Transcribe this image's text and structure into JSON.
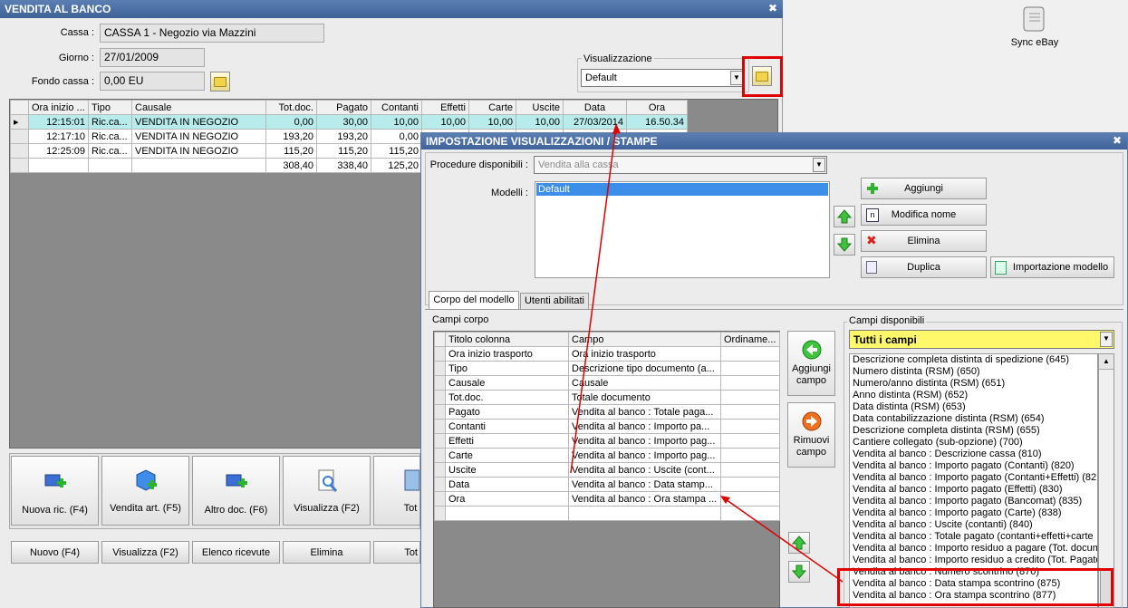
{
  "main_window": {
    "title": "VENDITA AL BANCO",
    "cassa_label": "Cassa :",
    "cassa_value": "CASSA 1 - Negozio via Mazzini",
    "giorno_label": "Giorno :",
    "giorno_value": "27/01/2009",
    "fondo_label": "Fondo cassa :",
    "fondo_value": "0,00 EU",
    "visualizzazione_label": "Visualizzazione",
    "visualizzazione_value": "Default",
    "table": {
      "headers": [
        "Ora inizio ...",
        "Tipo",
        "Causale",
        "Tot.doc.",
        "Pagato",
        "Contanti",
        "Effetti",
        "Carte",
        "Uscite",
        "Data",
        "Ora"
      ],
      "rows": [
        [
          "12:15:01",
          "Ric.ca...",
          "VENDITA IN NEGOZIO",
          "0,00",
          "30,00",
          "10,00",
          "10,00",
          "10,00",
          "10,00",
          "27/03/2014",
          "16.50.34"
        ],
        [
          "12:17:10",
          "Ric.ca...",
          "VENDITA IN NEGOZIO",
          "193,20",
          "193,20",
          "0,00",
          "",
          "",
          "",
          "",
          ""
        ],
        [
          "12:25:09",
          "Ric.ca...",
          "VENDITA IN NEGOZIO",
          "115,20",
          "115,20",
          "115,20",
          "",
          "",
          "",
          "",
          ""
        ],
        [
          "",
          "",
          "",
          "308,40",
          "338,40",
          "125,20",
          "",
          "",
          "",
          "",
          ""
        ]
      ]
    },
    "big_buttons": [
      "Nuova ric. (F4)",
      "Vendita art. (F5)",
      "Altro doc. (F6)",
      "Visualizza (F2)",
      "Tot"
    ],
    "bottom_buttons": [
      "Nuovo (F4)",
      "Visualizza (F2)",
      "Elenco ricevute",
      "Elimina",
      "Tot"
    ]
  },
  "desktop": {
    "sync_label": "Sync eBay"
  },
  "dialog": {
    "title": "IMPOSTAZIONE VISUALIZZAZIONI / STAMPE",
    "procedure_label": "Procedure disponibili :",
    "procedure_value": "Vendita alla cassa",
    "modelli_label": "Modelli :",
    "modelli_items": [
      "Default"
    ],
    "buttons": {
      "aggiungi": "Aggiungi",
      "modifica": "Modifica nome",
      "elimina": "Elimina",
      "duplica": "Duplica",
      "importazione": "Importazione modello"
    },
    "tabs": [
      "Corpo del modello",
      "Utenti abilitati"
    ],
    "campi_corpo_label": "Campi corpo",
    "campi_table": {
      "headers": [
        "Titolo colonna",
        "Campo",
        "Ordiname..."
      ],
      "rows": [
        [
          "Ora inizio trasporto",
          "Ora inizio trasporto",
          ""
        ],
        [
          "Tipo",
          "Descrizione tipo documento (a...",
          ""
        ],
        [
          "Causale",
          "Causale",
          ""
        ],
        [
          "Tot.doc.",
          "Totale documento",
          ""
        ],
        [
          "Pagato",
          "Vendita al banco : Totale paga...",
          ""
        ],
        [
          "Contanti",
          "Vendita al banco : Importo pa...",
          ""
        ],
        [
          "Effetti",
          "Vendita al banco : Importo pag...",
          ""
        ],
        [
          "Carte",
          "Vendita al banco : Importo pag...",
          ""
        ],
        [
          "Uscite",
          "Vendita al banco : Uscite (cont...",
          ""
        ],
        [
          "Data",
          "Vendita al banco : Data stamp...",
          ""
        ],
        [
          "Ora",
          "Vendita al banco : Ora stampa ...",
          ""
        ],
        [
          "",
          "",
          ""
        ]
      ]
    },
    "aggiungi_campo": "Aggiungi campo",
    "rimuovi_campo": "Rimuovi campo",
    "campi_disponibili_label": "Campi disponibili",
    "campi_filter": "Tutti i campi",
    "campi_list": [
      "Descrizione completa distinta di spedizione (645)",
      "Numero distinta (RSM) (650)",
      "Numero/anno distinta (RSM) (651)",
      "Anno distinta (RSM) (652)",
      "Data distinta (RSM) (653)",
      "Data contabilizzazione distinta (RSM) (654)",
      "Descrizione completa distinta (RSM) (655)",
      "Cantiere collegato (sub-opzione) (700)",
      "Vendita al banco : Descrizione cassa (810)",
      "Vendita al banco  : Importo pagato (Contanti) (820)",
      "Vendita al banco  : Importo pagato (Contanti+Effetti) (82",
      "Vendita al banco  : Importo pagato (Effetti) (830)",
      "Vendita al banco  : Importo pagato (Bancomat) (835)",
      "Vendita al banco  : Importo pagato (Carte) (838)",
      "Vendita al banco  : Uscite (contanti) (840)",
      "Vendita al banco  : Totale pagato (contanti+effetti+carte",
      "Vendita al banco : Importo residuo a pagare (Tot. docum",
      "Vendita al banco : Importo residuo a credito (Tot. Pagato",
      "Vendita al banco : Numero scontrino (870)",
      "Vendita al banco : Data stampa scontrino (875)",
      "Vendita al banco : Ora stampa scontrino (877)"
    ]
  }
}
